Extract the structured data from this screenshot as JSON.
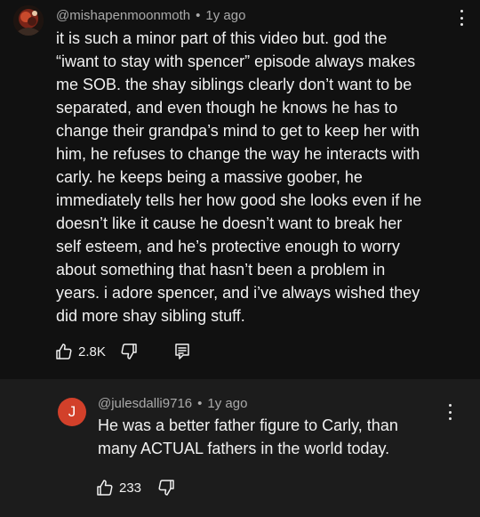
{
  "main_comment": {
    "handle": "@mishapenmoonmoth",
    "separator": "•",
    "age": "1y ago",
    "text": "it is such a minor part of this video but. god the\n“iwant to stay with spencer” episode always makes\nme SOB. the shay siblings clearly don’t want to be\nseparated, and even though he knows he has to\nchange their grandpa’s mind to get to keep her with\nhim, he refuses to change the way he interacts with\ncarly. he keeps being a massive goober, he\nimmediately tells her how good she looks even if he\ndoesn’t like it cause he doesn’t want to break her\nself esteem, and he’s protective enough to worry\nabout something that hasn’t been a problem in\nyears. i adore spencer, and i’ve always wished they\ndid more shay sibling stuff.",
    "like_count": "2.8K",
    "icons": {
      "like": "thumbs-up-icon",
      "dislike": "thumbs-down-icon",
      "reply": "comment-reply-icon",
      "menu": "kebab-menu-icon"
    }
  },
  "reply_comment": {
    "avatar_letter": "J",
    "avatar_color": "#d2402a",
    "handle": "@julesdalli9716",
    "separator": "•",
    "age": "1y ago",
    "text": "He was a better father figure to Carly, than\nmany ACTUAL fathers in the world today.",
    "like_count": "233",
    "icons": {
      "like": "thumbs-up-icon",
      "dislike": "thumbs-down-icon",
      "menu": "kebab-menu-icon"
    }
  }
}
